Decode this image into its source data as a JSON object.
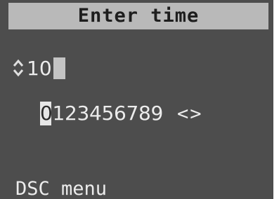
{
  "title": "Enter time",
  "entry": {
    "icon": "up-down-arrow-icon",
    "value": "10"
  },
  "digit_selector": {
    "digits": [
      "0",
      "1",
      "2",
      "3",
      "4",
      "5",
      "6",
      "7",
      "8",
      "9"
    ],
    "selected_index": 0,
    "arrows": "<>"
  },
  "softkey": {
    "label": "DSC menu"
  },
  "colors": {
    "screen_bg": "#4d4d4d",
    "title_bg": "#b9b9b9",
    "text": "#ececec",
    "highlight": "#e6e6e6"
  }
}
